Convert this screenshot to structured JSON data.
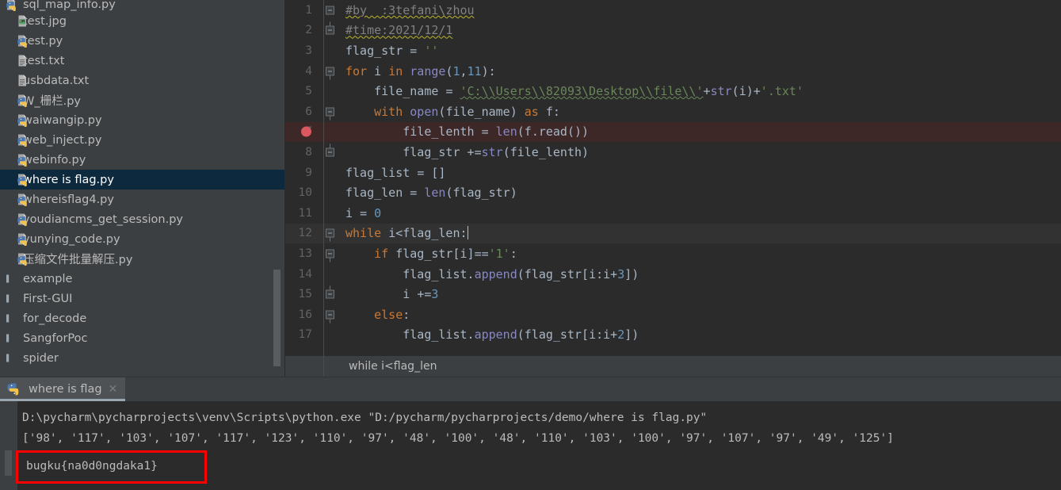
{
  "app": {
    "name": "PyCharm",
    "theme_bg": "#2b2b2b",
    "panel_bg": "#3c3f41",
    "accent": "#0d293e"
  },
  "sidebar": {
    "name": "project-tool-window",
    "partial_top_item": {
      "label": "sql_map_info.py",
      "icon": "python-file-icon"
    },
    "items": [
      {
        "label": "test.jpg",
        "icon": "image-file-icon",
        "type": "file",
        "selected": false
      },
      {
        "label": "test.py",
        "icon": "python-file-icon",
        "type": "file",
        "selected": false
      },
      {
        "label": "test.txt",
        "icon": "text-file-icon",
        "type": "file",
        "selected": false
      },
      {
        "label": "usbdata.txt",
        "icon": "text-file-icon",
        "type": "file",
        "selected": false
      },
      {
        "label": "W_栅栏.py",
        "icon": "python-file-icon",
        "type": "file",
        "selected": false
      },
      {
        "label": "waiwangip.py",
        "icon": "python-file-icon",
        "type": "file",
        "selected": false
      },
      {
        "label": "web_inject.py",
        "icon": "python-file-icon",
        "type": "file",
        "selected": false
      },
      {
        "label": "webinfo.py",
        "icon": "python-file-icon",
        "type": "file",
        "selected": false
      },
      {
        "label": "where is flag.py",
        "icon": "python-file-icon",
        "type": "file",
        "selected": true
      },
      {
        "label": "whereisflag4.py",
        "icon": "python-file-icon",
        "type": "file",
        "selected": false
      },
      {
        "label": "youdiancms_get_session.py",
        "icon": "python-file-icon",
        "type": "file",
        "selected": false
      },
      {
        "label": "yunying_code.py",
        "icon": "python-file-icon",
        "type": "file",
        "selected": false
      },
      {
        "label": "压缩文件批量解压.py",
        "icon": "python-file-icon",
        "type": "file",
        "selected": false
      },
      {
        "label": "example",
        "icon": "folder-icon",
        "type": "folder",
        "selected": false
      },
      {
        "label": "First-GUI",
        "icon": "folder-icon",
        "type": "folder",
        "selected": false
      },
      {
        "label": "for_decode",
        "icon": "folder-icon",
        "type": "folder",
        "selected": false
      },
      {
        "label": "SangforPoc",
        "icon": "folder-icon",
        "type": "folder",
        "selected": false
      },
      {
        "label": "spider",
        "icon": "folder-icon",
        "type": "folder",
        "selected": false
      }
    ]
  },
  "editor": {
    "name": "code-editor",
    "breakpoint_line": 7,
    "cursor_line": 12,
    "lines": [
      {
        "n": "1",
        "text": "#by  :3tefani\\zhou"
      },
      {
        "n": "2",
        "text": "#time:2021/12/1"
      },
      {
        "n": "3",
        "text": "flag_str = ''"
      },
      {
        "n": "4",
        "text": "for i in range(1,11):"
      },
      {
        "n": "5",
        "text": "    file_name = 'C:\\\\Users\\\\82093\\Desktop\\\\file\\\\'+str(i)+'.txt'"
      },
      {
        "n": "6",
        "text": "    with open(file_name) as f:"
      },
      {
        "n": "7",
        "text": "        file_lenth = len(f.read())"
      },
      {
        "n": "8",
        "text": "        flag_str +=str(file_lenth)"
      },
      {
        "n": "9",
        "text": "flag_list = []"
      },
      {
        "n": "10",
        "text": "flag_len = len(flag_str)"
      },
      {
        "n": "11",
        "text": "i = 0"
      },
      {
        "n": "12",
        "text": "while i<flag_len:"
      },
      {
        "n": "13",
        "text": "    if flag_str[i]=='1':"
      },
      {
        "n": "14",
        "text": "        flag_list.append(flag_str[i:i+3])"
      },
      {
        "n": "15",
        "text": "        i +=3"
      },
      {
        "n": "16",
        "text": "    else:"
      },
      {
        "n": "17",
        "text": "        flag_list.append(flag_str[i:i+2])"
      }
    ]
  },
  "breadcrumb": {
    "text": "while i<flag_len"
  },
  "run_tab": {
    "label": "where is flag",
    "icon": "python-file-icon",
    "close_icon": "close-icon"
  },
  "console": {
    "name": "run-console",
    "command_line": "D:\\pycharm\\pycharprojects\\venv\\Scripts\\python.exe \"D:/pycharm/pycharprojects/demo/where is flag.py\"",
    "output_list": "['98', '117', '103', '107', '117', '123', '110', '97', '48', '100', '48', '110', '103', '100', '97', '107', '97', '49', '125']",
    "flag": "bugku{na0d0ngdaka1}",
    "highlight_color": "#ff0000"
  }
}
